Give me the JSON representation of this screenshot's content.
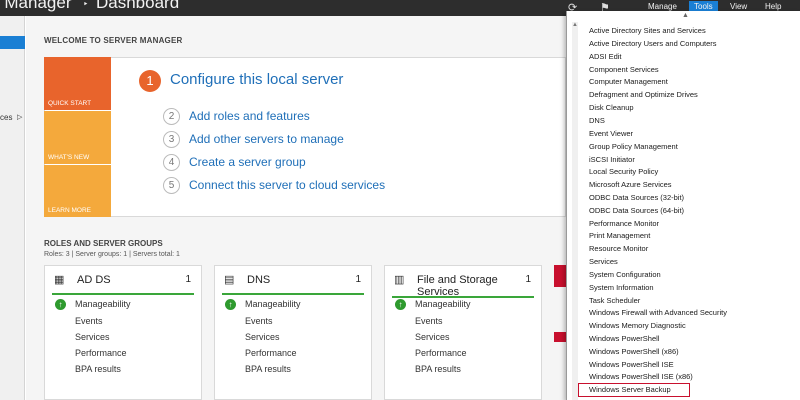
{
  "window": {
    "title": "r Manager",
    "separator": "‣",
    "page": "Dashboard"
  },
  "titlebar": {
    "refresh_icon": "refresh-icon",
    "flag_icon": "flag-icon",
    "menus": [
      "Manage",
      "Tools",
      "View",
      "Help"
    ],
    "active_menu": "Tools",
    "active_color": "#1a7fd4"
  },
  "leftnav": {
    "partial_item": "ces",
    "arrow": "▷"
  },
  "welcome": {
    "heading": "WELCOME TO SERVER MANAGER",
    "tiles": [
      "QUICK START",
      "WHAT'S NEW",
      "LEARN MORE"
    ],
    "steps": [
      {
        "num": "1",
        "label": "Configure this local server"
      },
      {
        "num": "2",
        "label": "Add roles and features"
      },
      {
        "num": "3",
        "label": "Add other servers to manage"
      },
      {
        "num": "4",
        "label": "Create a server group"
      },
      {
        "num": "5",
        "label": "Connect this server to cloud services"
      }
    ]
  },
  "roles": {
    "heading": "ROLES AND SERVER GROUPS",
    "summary": "Roles: 3   |   Server groups: 1   |   Servers total: 1",
    "cards": [
      {
        "title": "AD DS",
        "count": "1",
        "rows": [
          "Manageability",
          "Events",
          "Services",
          "Performance",
          "BPA results"
        ]
      },
      {
        "title": "DNS",
        "count": "1",
        "rows": [
          "Manageability",
          "Events",
          "Services",
          "Performance",
          "BPA results"
        ]
      },
      {
        "title": "File and Storage Services",
        "count": "1",
        "rows": [
          "Manageability",
          "Events",
          "Services",
          "Performance",
          "BPA results"
        ]
      }
    ],
    "status_color": "#3aa63a"
  },
  "tools_menu": {
    "items": [
      "Active Directory Sites and Services",
      "Active Directory Users and Computers",
      "ADSI Edit",
      "Component Services",
      "Computer Management",
      "Defragment and Optimize Drives",
      "Disk Cleanup",
      "DNS",
      "Event Viewer",
      "Group Policy Management",
      "iSCSI Initiator",
      "Local Security Policy",
      "Microsoft Azure Services",
      "ODBC Data Sources (32-bit)",
      "ODBC Data Sources (64-bit)",
      "Performance Monitor",
      "Print Management",
      "Resource Monitor",
      "Services",
      "System Configuration",
      "System Information",
      "Task Scheduler",
      "Windows Firewall with Advanced Security",
      "Windows Memory Diagnostic",
      "Windows PowerShell",
      "Windows PowerShell (x86)",
      "Windows PowerShell ISE",
      "Windows PowerShell ISE (x86)",
      "Windows Server Backup"
    ],
    "highlighted": "Windows Server Backup",
    "highlight_color": "#c8102e"
  }
}
